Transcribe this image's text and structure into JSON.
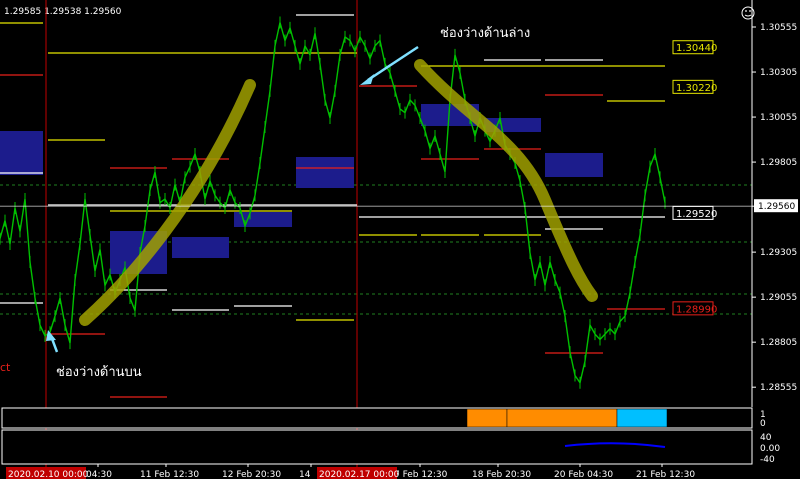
{
  "header": {
    "ohlc_text": "1.29585 1.29538 1.29560"
  },
  "icons": {
    "corner": "smiley-face-icon"
  },
  "left_partial_label": "ct",
  "chart_data": {
    "type": "line",
    "symbol_ohlc": "1.29585 1.29538 1.29560",
    "y_ticks": [
      "1.30555",
      "1.30305",
      "1.30055",
      "1.29805",
      "1.29560",
      "1.29305",
      "1.29055",
      "1.28805",
      "1.28555"
    ],
    "y_tick_values": [
      1.30555,
      1.30305,
      1.30055,
      1.29805,
      1.2956,
      1.29305,
      1.29055,
      1.28805,
      1.28555
    ],
    "ylim": [
      1.28445,
      1.30705
    ],
    "current_price": 1.2956,
    "current_price_label": "1.29560",
    "x_tick_labels": [
      "04:30",
      "11 Feb 12:30",
      "12 Feb 20:30",
      "14",
      "7 Feb 12:30",
      "18 Feb 20:30",
      "20 Feb 04:30",
      "21 Feb 12:30"
    ],
    "x_tick_positions": [
      98,
      166,
      248,
      311,
      420,
      498,
      580,
      662
    ],
    "x_tick_unit": "column",
    "highlight_labels": [
      "2020.02.10 00:00",
      "2020.02.17 00:00"
    ],
    "highlight_positions": [
      46,
      357
    ],
    "price_boxes": [
      {
        "label": "1.30440",
        "value": 1.3044,
        "color": "#e6e600"
      },
      {
        "label": "1.30220",
        "value": 1.3022,
        "color": "#e6e600"
      },
      {
        "label": "1.29520",
        "value": 1.2952,
        "color": "#ffffff"
      },
      {
        "label": "1.28990",
        "value": 1.2899,
        "color": "#e8201a"
      }
    ],
    "annotations": [
      {
        "text": "ช่องว่างด้านล่าง"
      },
      {
        "text": "ช่องว่างด้านบน"
      }
    ],
    "indicator1_ticks": [
      "1",
      "0"
    ],
    "indicator2_ticks": [
      "40",
      "0.00",
      "-40"
    ],
    "series": [
      {
        "points": [
          [
            0,
            1.2938
          ],
          [
            5,
            1.2948
          ],
          [
            10,
            1.2935
          ],
          [
            15,
            1.2955
          ],
          [
            20,
            1.2942
          ],
          [
            25,
            1.296
          ],
          [
            30,
            1.2925
          ],
          [
            35,
            1.2905
          ],
          [
            40,
            1.289
          ],
          [
            45,
            1.2884
          ],
          [
            50,
            1.2886
          ],
          [
            55,
            1.2895
          ],
          [
            60,
            1.2905
          ],
          [
            65,
            1.289
          ],
          [
            70,
            1.288
          ],
          [
            75,
            1.2915
          ],
          [
            80,
            1.2935
          ],
          [
            85,
            1.296
          ],
          [
            90,
            1.294
          ],
          [
            95,
            1.292
          ],
          [
            100,
            1.2932
          ],
          [
            105,
            1.2912
          ],
          [
            110,
            1.2918
          ],
          [
            115,
            1.2908
          ],
          [
            120,
            1.2915
          ],
          [
            125,
            1.2922
          ],
          [
            130,
            1.2905
          ],
          [
            135,
            1.2898
          ],
          [
            140,
            1.293
          ],
          [
            145,
            1.2945
          ],
          [
            150,
            1.2965
          ],
          [
            155,
            1.2975
          ],
          [
            160,
            1.2958
          ],
          [
            165,
            1.296
          ],
          [
            170,
            1.2955
          ],
          [
            175,
            1.2968
          ],
          [
            180,
            1.2958
          ],
          [
            185,
            1.2972
          ],
          [
            190,
            1.2978
          ],
          [
            195,
            1.2985
          ],
          [
            200,
            1.2975
          ],
          [
            205,
            1.296
          ],
          [
            210,
            1.297
          ],
          [
            215,
            1.2962
          ],
          [
            220,
            1.2958
          ],
          [
            225,
            1.2955
          ],
          [
            230,
            1.2965
          ],
          [
            235,
            1.2958
          ],
          [
            240,
            1.2955
          ],
          [
            245,
            1.2945
          ],
          [
            250,
            1.2952
          ],
          [
            255,
            1.2962
          ],
          [
            260,
            1.298
          ],
          [
            265,
            1.3
          ],
          [
            270,
            1.302
          ],
          [
            275,
            1.3045
          ],
          [
            280,
            1.3058
          ],
          [
            285,
            1.3048
          ],
          [
            290,
            1.3055
          ],
          [
            295,
            1.3045
          ],
          [
            300,
            1.3035
          ],
          [
            305,
            1.3045
          ],
          [
            310,
            1.304
          ],
          [
            315,
            1.3052
          ],
          [
            320,
            1.3035
          ],
          [
            325,
            1.3015
          ],
          [
            330,
            1.3005
          ],
          [
            335,
            1.302
          ],
          [
            340,
            1.304
          ],
          [
            345,
            1.305
          ],
          [
            350,
            1.3048
          ],
          [
            355,
            1.3042
          ],
          [
            360,
            1.305
          ],
          [
            365,
            1.3045
          ],
          [
            370,
            1.3038
          ],
          [
            375,
            1.3045
          ],
          [
            380,
            1.3048
          ],
          [
            385,
            1.3035
          ],
          [
            390,
            1.303
          ],
          [
            395,
            1.302
          ],
          [
            400,
            1.301
          ],
          [
            405,
            1.3008
          ],
          [
            410,
            1.3015
          ],
          [
            415,
            1.3012
          ],
          [
            420,
            1.3005
          ],
          [
            425,
            1.2998
          ],
          [
            430,
            1.2988
          ],
          [
            435,
            1.2995
          ],
          [
            440,
            1.2985
          ],
          [
            445,
            1.2975
          ],
          [
            450,
            1.3015
          ],
          [
            455,
            1.304
          ],
          [
            460,
            1.303
          ],
          [
            465,
            1.3015
          ],
          [
            470,
            1.3005
          ],
          [
            475,
            1.2995
          ],
          [
            480,
            1.3005
          ],
          [
            485,
            1.2998
          ],
          [
            490,
            1.2992
          ],
          [
            495,
            1.2998
          ],
          [
            500,
            1.3005
          ],
          [
            505,
            1.299
          ],
          [
            510,
            1.2985
          ],
          [
            515,
            1.298
          ],
          [
            520,
            1.297
          ],
          [
            525,
            1.2955
          ],
          [
            530,
            1.293
          ],
          [
            535,
            1.2915
          ],
          [
            540,
            1.2925
          ],
          [
            545,
            1.2912
          ],
          [
            550,
            1.2925
          ],
          [
            555,
            1.2915
          ],
          [
            560,
            1.2908
          ],
          [
            565,
            1.2895
          ],
          [
            570,
            1.2875
          ],
          [
            575,
            1.2862
          ],
          [
            580,
            1.2858
          ],
          [
            585,
            1.287
          ],
          [
            590,
            1.289
          ],
          [
            595,
            1.2885
          ],
          [
            600,
            1.2882
          ],
          [
            605,
            1.2885
          ],
          [
            610,
            1.2888
          ],
          [
            615,
            1.2885
          ],
          [
            620,
            1.2892
          ],
          [
            625,
            1.2895
          ],
          [
            630,
            1.2908
          ],
          [
            635,
            1.2925
          ],
          [
            640,
            1.294
          ],
          [
            645,
            1.2962
          ],
          [
            650,
            1.2978
          ],
          [
            655,
            1.2985
          ],
          [
            660,
            1.2972
          ],
          [
            665,
            1.2958
          ]
        ],
        "color": "#00c000"
      }
    ],
    "indicator1_blocks": [
      {
        "from": 467,
        "to": 507,
        "color": "#ff8c00"
      },
      {
        "from": 507,
        "to": 617,
        "color": "#ff8c00"
      },
      {
        "from": 617,
        "to": 667,
        "color": "#00bfff"
      }
    ],
    "indicator2_segment": {
      "from": 565,
      "to": 665,
      "color": "#0000ff"
    }
  },
  "colors": {
    "background": "#000000",
    "price_line": "#00c000",
    "zone_fill": "#1c1c8c",
    "highlight_line": "#c00000",
    "annotation_stroke": "#a0a000",
    "arrow": "#7fe0ff"
  }
}
